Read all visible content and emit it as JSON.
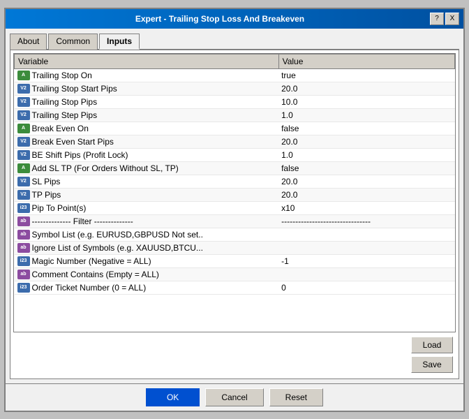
{
  "window": {
    "title": "Expert - Trailing Stop Loss And Breakeven",
    "help_btn": "?",
    "close_btn": "X"
  },
  "tabs": [
    {
      "id": "about",
      "label": "About",
      "active": false
    },
    {
      "id": "common",
      "label": "Common",
      "active": false
    },
    {
      "id": "inputs",
      "label": "Inputs",
      "active": true
    }
  ],
  "table": {
    "col_variable": "Variable",
    "col_value": "Value",
    "rows": [
      {
        "icon": "bool",
        "icon_label": "A",
        "variable": "Trailing Stop On",
        "value": "true"
      },
      {
        "icon": "num",
        "icon_label": "V2",
        "variable": "Trailing Stop Start Pips",
        "value": "20.0"
      },
      {
        "icon": "num",
        "icon_label": "V2",
        "variable": "Trailing Stop Pips",
        "value": "10.0"
      },
      {
        "icon": "num",
        "icon_label": "V2",
        "variable": "Trailing Step Pips",
        "value": "1.0"
      },
      {
        "icon": "bool",
        "icon_label": "A",
        "variable": "Break Even On",
        "value": "false"
      },
      {
        "icon": "num",
        "icon_label": "V2",
        "variable": "Break Even Start Pips",
        "value": "20.0"
      },
      {
        "icon": "num",
        "icon_label": "V2",
        "variable": "BE Shift Pips (Profit Lock)",
        "value": "1.0"
      },
      {
        "icon": "bool",
        "icon_label": "A",
        "variable": "Add SL TP (For Orders Without SL, TP)",
        "value": "false"
      },
      {
        "icon": "num",
        "icon_label": "V2",
        "variable": "SL Pips",
        "value": "20.0"
      },
      {
        "icon": "num",
        "icon_label": "V2",
        "variable": "TP Pips",
        "value": "20.0"
      },
      {
        "icon": "int",
        "icon_label": "i23",
        "variable": "Pip To Point(s)",
        "value": "x10"
      },
      {
        "icon": "str",
        "icon_label": "ab",
        "variable": "-------------- Filter --------------",
        "value": "--------------------------------"
      },
      {
        "icon": "str",
        "icon_label": "ab",
        "variable": "Symbol List (e.g. EURUSD,GBPUSD Not set..",
        "value": ""
      },
      {
        "icon": "str",
        "icon_label": "ab",
        "variable": "Ignore List of Symbols (e.g. XAUUSD,BTCU...",
        "value": ""
      },
      {
        "icon": "int",
        "icon_label": "i23",
        "variable": "Magic Number (Negative = ALL)",
        "value": "-1"
      },
      {
        "icon": "str",
        "icon_label": "ab",
        "variable": "Comment Contains (Empty = ALL)",
        "value": ""
      },
      {
        "icon": "int",
        "icon_label": "i23",
        "variable": "Order Ticket Number (0 = ALL)",
        "value": "0"
      }
    ]
  },
  "buttons": {
    "load": "Load",
    "save": "Save",
    "ok": "OK",
    "cancel": "Cancel",
    "reset": "Reset"
  }
}
